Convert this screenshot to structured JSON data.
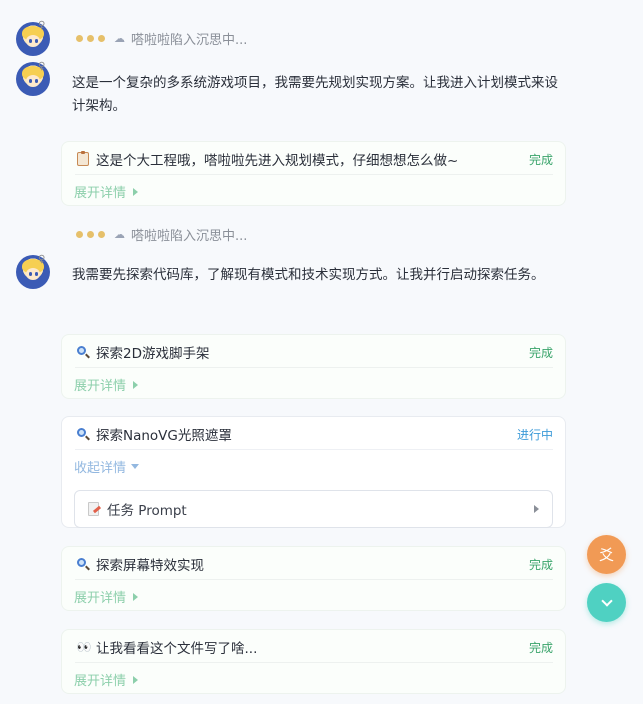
{
  "thinking_text": "嗒啦啦陷入沉思中...",
  "messages": [
    {
      "text": "这是一个复杂的多系统游戏项目，我需要先规划实现方案。让我进入计划模式来设计架构。"
    },
    {
      "text": "我需要先探索代码库，了解现有模式和技术实现方式。让我并行启动探索任务。"
    }
  ],
  "cards": [
    {
      "icon": "clipboard-icon",
      "title": "这是个大工程哦，嗒啦啦先进入规划模式，仔细想想怎么做~",
      "status": "完成",
      "toggle": "展开详情"
    },
    {
      "icon": "magnifier-icon",
      "title": "探索2D游戏脚手架",
      "status": "完成",
      "toggle": "展开详情"
    },
    {
      "icon": "magnifier-icon",
      "title": "探索NanoVG光照遮罩",
      "status": "进行中",
      "toggle": "收起详情",
      "prompt_label": "任务 Prompt"
    },
    {
      "icon": "magnifier-icon",
      "title": "探索屏幕特效实现",
      "status": "完成",
      "toggle": "展开详情"
    },
    {
      "icon": "eyes-icon",
      "title": "让我看看这个文件写了啥...",
      "status": "完成",
      "toggle": "展开详情"
    }
  ],
  "fab": {
    "bug_label": "爻"
  },
  "colors": {
    "accent_green": "#3aa46b",
    "accent_blue": "#3b9ad8",
    "fab_orange": "#f19a55",
    "fab_teal": "#4fd1c2"
  }
}
